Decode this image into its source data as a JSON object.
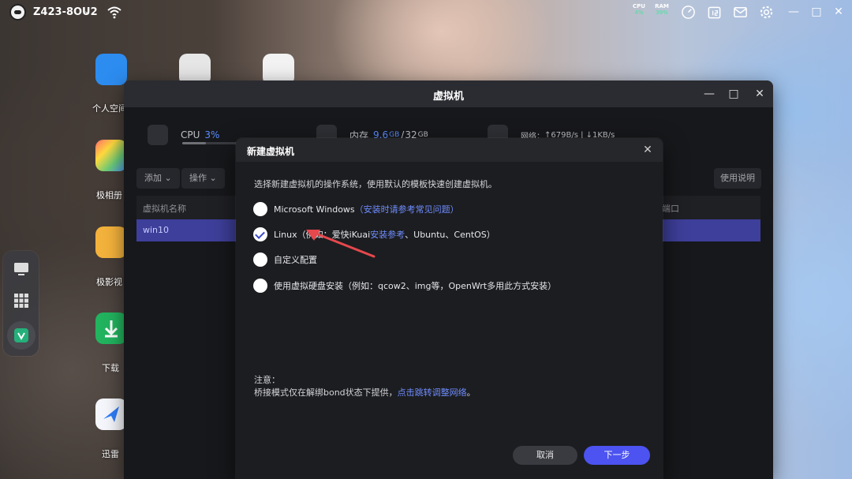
{
  "topbar": {
    "device_name": "Z423-8OU2",
    "cpu_label": "CPU",
    "cpu_value": "4%",
    "ram_label": "RAM",
    "ram_value": "39%"
  },
  "desktop": {
    "icons": [
      {
        "label": "个人空间"
      },
      {
        "label": "极相册"
      },
      {
        "label": "极影视"
      },
      {
        "label": "下载"
      },
      {
        "label": "迅雷"
      }
    ]
  },
  "vm_window": {
    "title": "虚拟机",
    "cpu_label": "CPU",
    "cpu_value": "3%",
    "cpu_percent": 3,
    "mem_label": "内存",
    "mem_used": "9.6",
    "mem_used_unit": "GB",
    "mem_sep": "/",
    "mem_total": "32",
    "mem_total_unit": "GB",
    "network_label": "网络：",
    "network_value": "↑679B/s | ↓1KB/s",
    "add_label": "添加",
    "ops_label": "操作",
    "help_label": "使用说明",
    "col_name": "虚拟机名称",
    "col_port": "端口",
    "row_name": "win10"
  },
  "modal": {
    "title": "新建虚拟机",
    "description": "选择新建虚拟机的操作系统，使用默认的模板快速创建虚拟机。",
    "options": [
      {
        "text": "Microsoft Windows",
        "link": "（安装时请参考常见问题）",
        "checked": false
      },
      {
        "text_pre": "Linux（例如：爱快iKuai",
        "link": "安装参考",
        "text_post": "、Ubuntu、CentOS）",
        "checked": true
      },
      {
        "text": "自定义配置",
        "checked": false
      },
      {
        "text": "使用虚拟硬盘安装（例如：qcow2、img等，OpenWrt多用此方式安装）",
        "checked": false
      }
    ],
    "note_title": "注意：",
    "note_text": "桥接模式仅在解绑bond状态下提供，",
    "note_link": "点击跳转调整网络",
    "note_end": "。",
    "cancel_label": "取消",
    "next_label": "下一步"
  },
  "colors": {
    "accent": "#4c53f0",
    "link": "#6f8dff",
    "selected_row": "#3e3f9a",
    "arrow": "#e5484d"
  }
}
